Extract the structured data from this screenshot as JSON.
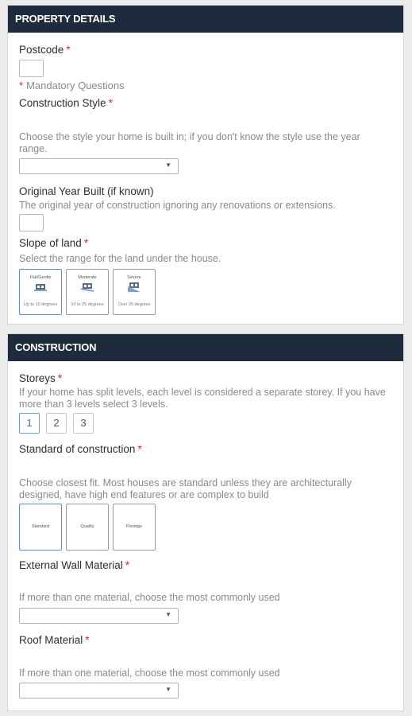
{
  "property": {
    "header": "PROPERTY DETAILS",
    "postcode_label": "Postcode",
    "required_mark": "*",
    "mandatory_note": "Mandatory Questions",
    "construction_style_label": "Construction Style",
    "construction_style_help": "Choose the style your home is built in; if you don't know the style use the year range.",
    "year_built_label": "Original Year Built (if known)",
    "year_built_help": "The original year of construction ignoring any renovations or extensions.",
    "slope_label": "Slope of land",
    "slope_help": "Select the range for the land under the house.",
    "slope_options": [
      {
        "title": "Flat/Gentle",
        "sub": "Up to 10 degrees",
        "selected": true
      },
      {
        "title": "Moderate",
        "sub": "10 to 25 degrees",
        "selected": false
      },
      {
        "title": "Severe",
        "sub": "Over 25 degrees",
        "selected": false
      }
    ]
  },
  "construction": {
    "header": "CONSTRUCTION",
    "storeys_label": "Storeys",
    "storeys_help": "If your home has split levels, each level is considered a separate storey. If you have more than 3 levels select 3 levels.",
    "storeys_options": [
      "1",
      "2",
      "3"
    ],
    "storeys_selected": "1",
    "standard_label": "Standard of construction",
    "standard_help": "Choose closest fit. Most houses are standard unless they are architecturally designed, have high end features or are complex to build",
    "standard_options": [
      {
        "title": "Standard",
        "selected": true
      },
      {
        "title": "Quality",
        "selected": false
      },
      {
        "title": "Prestige",
        "selected": false
      }
    ],
    "wall_label": "External Wall Material",
    "wall_help": "If more than one material, choose the most commonly used",
    "roof_label": "Roof Material",
    "roof_help": "If more than one material, choose the most commonly used"
  },
  "icons": {
    "dropdown": "chevron-down-icon",
    "slope_flat": "house-flat-slope-icon",
    "slope_moderate": "house-moderate-slope-icon",
    "slope_severe": "house-severe-slope-icon"
  },
  "colors": {
    "header_bg": "#1e2b3c",
    "required": "#e0232b",
    "selected_border": "#5b8ed1"
  }
}
